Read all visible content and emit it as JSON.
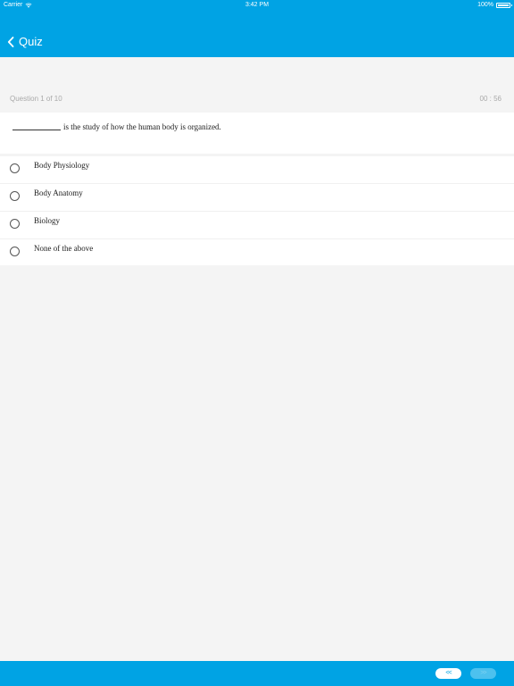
{
  "status_bar": {
    "carrier": "Carrier",
    "time": "3:42 PM",
    "battery": "100%",
    "battery_level": 1.0,
    "icons": [
      "wifi-icon",
      "battery-icon"
    ]
  },
  "nav": {
    "back_icon": "chevron-left-icon",
    "title": "Quiz"
  },
  "quiz": {
    "counter": "Question 1 of 10",
    "timer": "00 : 56",
    "question_text": "is the study of how the human body is organized.",
    "options": [
      {
        "label": "Body Physiology",
        "selected": false
      },
      {
        "label": "Body Anatomy",
        "selected": false
      },
      {
        "label": "Biology",
        "selected": false
      },
      {
        "label": "None of the above",
        "selected": false
      }
    ]
  },
  "footer": {
    "prev_label": "<<",
    "next_label": ">>"
  },
  "colors": {
    "accent": "#00a3e4",
    "background": "#f4f4f4",
    "muted_text": "#a9a9a9"
  }
}
